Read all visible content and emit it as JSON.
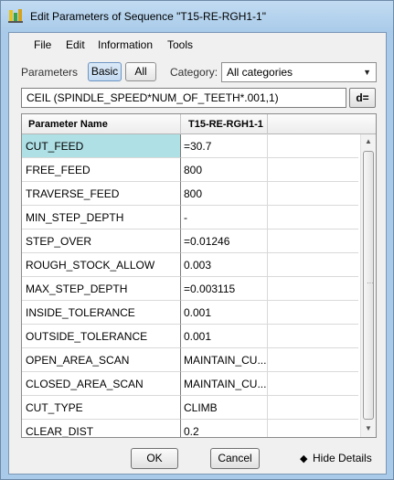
{
  "window": {
    "title": "Edit Parameters of Sequence \"T15-RE-RGH1-1\""
  },
  "menu": [
    "File",
    "Edit",
    "Information",
    "Tools"
  ],
  "filter": {
    "parameters_label": "Parameters",
    "basic_label": "Basic",
    "all_label": "All",
    "category_label": "Category:",
    "category_value": "All categories"
  },
  "formula": {
    "value": "CEIL (SPINDLE_SPEED*NUM_OF_TEETH*.001,1)",
    "button_label": "d="
  },
  "table": {
    "headers": [
      "Parameter Name",
      "T15-RE-RGH1-1"
    ],
    "rows": [
      {
        "name": "CUT_FEED",
        "value": "=30.7"
      },
      {
        "name": "FREE_FEED",
        "value": "800"
      },
      {
        "name": "TRAVERSE_FEED",
        "value": "800"
      },
      {
        "name": "MIN_STEP_DEPTH",
        "value": "-"
      },
      {
        "name": "STEP_OVER",
        "value": "=0.01246"
      },
      {
        "name": "ROUGH_STOCK_ALLOW",
        "value": "0.003"
      },
      {
        "name": "MAX_STEP_DEPTH",
        "value": "=0.003115"
      },
      {
        "name": "INSIDE_TOLERANCE",
        "value": "0.001"
      },
      {
        "name": "OUTSIDE_TOLERANCE",
        "value": "0.001"
      },
      {
        "name": "OPEN_AREA_SCAN",
        "value": "MAINTAIN_CU..."
      },
      {
        "name": "CLOSED_AREA_SCAN",
        "value": "MAINTAIN_CU..."
      },
      {
        "name": "CUT_TYPE",
        "value": "CLIMB"
      },
      {
        "name": "CLEAR_DIST",
        "value": "0.2"
      }
    ]
  },
  "footer": {
    "ok_label": "OK",
    "cancel_label": "Cancel",
    "hide_details_label": "Hide Details"
  },
  "colors": {
    "selected_row": "#aee0e5",
    "title_bar": "#a9cbe9"
  }
}
